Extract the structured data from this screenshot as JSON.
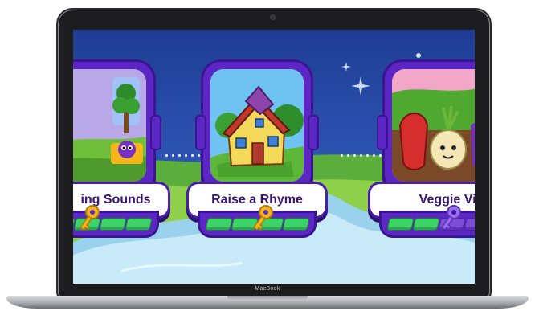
{
  "device": {
    "brand_label": "MacBook"
  },
  "level_map": {
    "cards": [
      {
        "title": "ing Sounds",
        "picture_icon": "tree-with-purple-monster-icon",
        "progress": {
          "filled": 4,
          "total": 4
        },
        "key": {
          "icon": "gold-key-icon",
          "color": "#f2b51d"
        }
      },
      {
        "title": "Raise a Rhyme",
        "picture_icon": "crooked-house-icon",
        "progress": {
          "filled": 4,
          "total": 4
        },
        "key": {
          "icon": "gold-key-icon",
          "color": "#f2b51d"
        }
      },
      {
        "title": "Veggie Villa",
        "picture_icon": "veggie-characters-icon",
        "progress": {
          "filled": 2,
          "total": 4
        },
        "key": {
          "icon": "purple-key-icon",
          "color": "#9a6cf0"
        }
      }
    ]
  },
  "colors": {
    "sky": "#2a4fa8",
    "card_frame": "#5b26c4",
    "progress_green": "#3fd16a",
    "title_text": "#3a1670"
  }
}
